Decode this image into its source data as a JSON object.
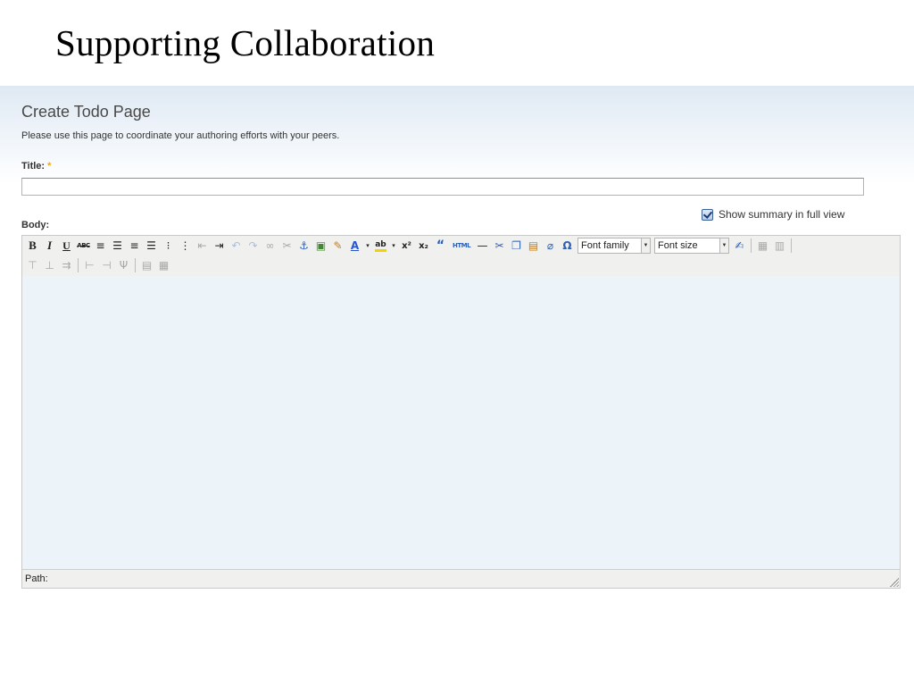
{
  "slide": {
    "title": "Supporting Collaboration"
  },
  "page": {
    "heading": "Create Todo Page",
    "intro": "Please use this page to coordinate your authoring efforts with your peers.",
    "title_label": "Title:",
    "required_marker": "*",
    "title_value": "",
    "body_label": "Body:",
    "summary_toggle": {
      "label": "Show summary in full view",
      "checked": true
    }
  },
  "editor": {
    "toolbar": {
      "bold": "B",
      "italic": "I",
      "underline": "U",
      "strikethrough": "ABC",
      "forecolor": "A",
      "backcolor": "ab",
      "html": "HTML",
      "font_family": "Font family",
      "font_size": "Font size"
    },
    "colors": {
      "forecolor": "#2a55c8",
      "backcolor": "#f2d200",
      "accent": "#2e5fb5"
    },
    "status": {
      "path_label": "Path:"
    }
  }
}
